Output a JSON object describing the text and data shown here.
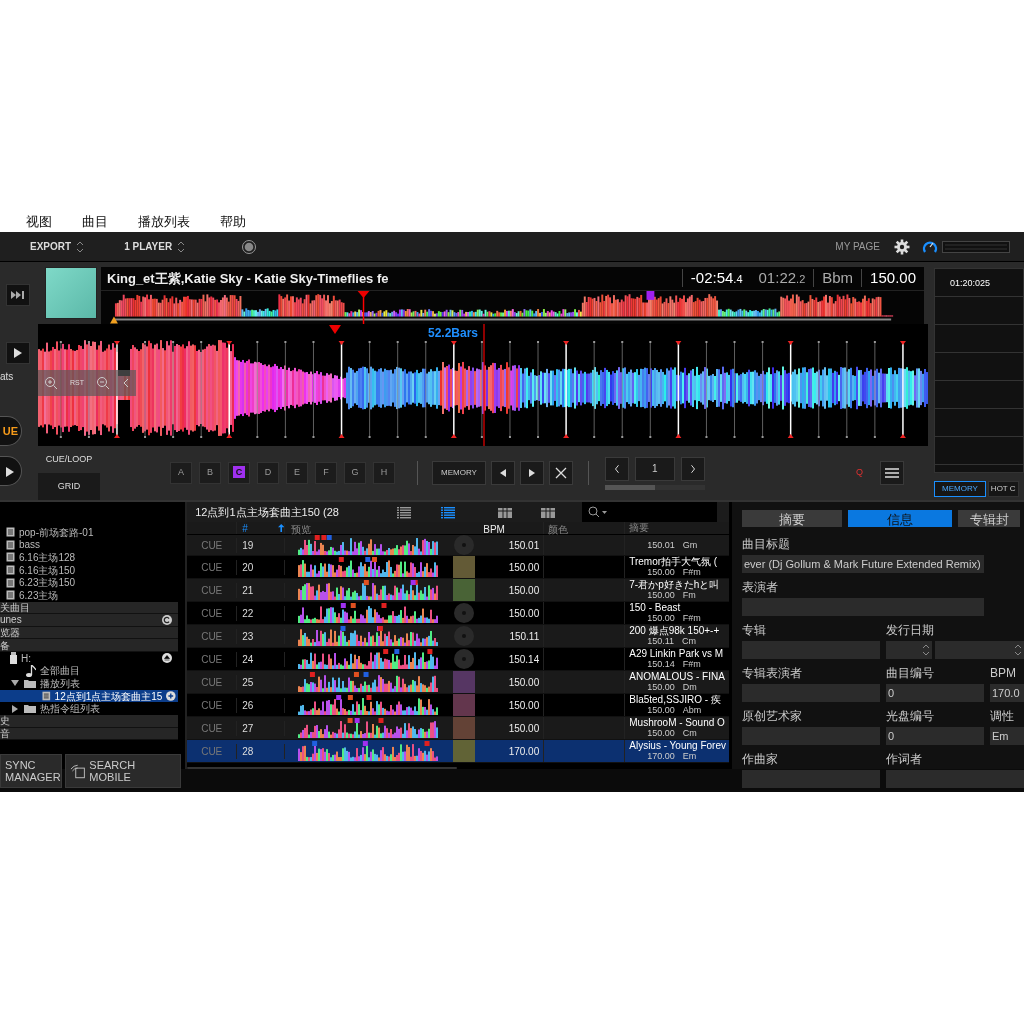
{
  "menu": [
    "视图",
    "曲目",
    "播放列表",
    "帮助"
  ],
  "toolbar": {
    "export": "EXPORT",
    "players": "1 PLAYER",
    "my_page": "MY PAGE"
  },
  "deck": {
    "side_labels": [
      "ats",
      "UE"
    ],
    "title": "King_et王紫,Katie Sky - Katie Sky-Timeflies fe",
    "remaining": "-02:54",
    "remaining_tenths": ".4",
    "elapsed": "01:22",
    "elapsed_tenths": ".2",
    "key": "Bbm",
    "bpm": "150.00",
    "bars": "52.2Bars",
    "zoom_reset": "RST",
    "mode_tabs": [
      {
        "label": "CUE/LOOP",
        "selected": true
      },
      {
        "label": "GRID",
        "selected": false
      }
    ],
    "hot_cues": [
      {
        "label": "A",
        "set": false
      },
      {
        "label": "B",
        "set": false
      },
      {
        "label": "C",
        "set": true
      },
      {
        "label": "D",
        "set": false
      },
      {
        "label": "E",
        "set": false
      },
      {
        "label": "F",
        "set": false
      },
      {
        "label": "G",
        "set": false
      },
      {
        "label": "H",
        "set": false
      }
    ],
    "memory_button": "MEMORY",
    "loop_value": "1",
    "loop_progress": {
      "level": 0.5
    },
    "quantize": "Q"
  },
  "memory_panel": {
    "cues": [
      "01:20:025"
    ],
    "tabs": [
      {
        "label": "MEMORY",
        "selected": true
      },
      {
        "label": "HOT C",
        "selected": false
      }
    ]
  },
  "tree": [
    {
      "kind": "playlist",
      "label": "pop-前场套路-01",
      "selected": false
    },
    {
      "kind": "playlist",
      "label": "bass",
      "selected": false
    },
    {
      "kind": "playlist",
      "label": "6.16主场128",
      "selected": false
    },
    {
      "kind": "playlist",
      "label": "6.16主场150",
      "selected": false
    },
    {
      "kind": "playlist",
      "label": "6.23主场150",
      "selected": false
    },
    {
      "kind": "playlist",
      "label": "6.23主场",
      "selected": false
    },
    {
      "kind": "section",
      "label": "关曲目"
    },
    {
      "kind": "library",
      "label": "unes"
    },
    {
      "kind": "section",
      "label": "览器"
    },
    {
      "kind": "section",
      "label": "备",
      "children": [
        {
          "kind": "device",
          "label": "H:",
          "children": [
            {
              "kind": "all",
              "label": "全部曲目"
            },
            {
              "kind": "folder",
              "label": "播放列表",
              "expanded": true,
              "children": [
                {
                  "kind": "playlist",
                  "label": "12点到1点主场套曲主15",
                  "selected": true
                }
              ]
            },
            {
              "kind": "folder",
              "label": "热指令组列表",
              "expanded": false
            }
          ]
        }
      ]
    },
    {
      "kind": "section",
      "label": "史"
    },
    {
      "kind": "section",
      "label": "音"
    }
  ],
  "tree_buttons": [
    "SYNC MANAGER",
    "SEARCH MOBILE"
  ],
  "track_list": {
    "title": "12点到1点主场套曲主150 (28",
    "view_buttons": [
      {
        "kind": "list",
        "selected": false
      },
      {
        "kind": "list",
        "selected": true
      },
      {
        "kind": "grid",
        "selected": false
      },
      {
        "kind": "grid",
        "selected": false
      }
    ],
    "columns": [
      "#",
      "预览",
      "BPM",
      "颜色",
      "摘要"
    ],
    "rows": [
      {
        "cue": "CUE",
        "number": "19",
        "bpm": "150.01",
        "summary_bpm": "150.01",
        "key": "Gm",
        "has_artwork": false,
        "selected": false
      },
      {
        "cue": "CUE",
        "number": "20",
        "bpm": "150.00",
        "title": "Tremor拍手大气氛 (",
        "summary_bpm": "150.00",
        "key": "F#m",
        "has_artwork": true,
        "selected": false
      },
      {
        "cue": "CUE",
        "number": "21",
        "bpm": "150.00",
        "title": "7-君かp好きたhと叫",
        "summary_bpm": "150.00",
        "key": "Fm",
        "has_artwork": true,
        "selected": false
      },
      {
        "cue": "CUE",
        "number": "22",
        "bpm": "150.00",
        "title": "150 - Beast",
        "summary_bpm": "150.00",
        "key": "F#m",
        "has_artwork": false,
        "selected": false
      },
      {
        "cue": "CUE",
        "number": "23",
        "bpm": "150.11",
        "title": "200 爆点98k 150+-+",
        "summary_bpm": "150.11",
        "key": "Cm",
        "has_artwork": false,
        "selected": false
      },
      {
        "cue": "CUE",
        "number": "24",
        "bpm": "150.14",
        "title": "A29  Linkin Park vs M",
        "summary_bpm": "150.14",
        "key": "F#m",
        "has_artwork": false,
        "selected": false
      },
      {
        "cue": "CUE",
        "number": "25",
        "bpm": "150.00",
        "title": "ANOMALOUS - FINA",
        "summary_bpm": "150.00",
        "key": "Dm",
        "has_artwork": true,
        "selected": false
      },
      {
        "cue": "CUE",
        "number": "26",
        "bpm": "150.00",
        "title": "Bla5ted,SSJIRO - 疾",
        "summary_bpm": "150.00",
        "key": "Abm",
        "has_artwork": true,
        "selected": false
      },
      {
        "cue": "CUE",
        "number": "27",
        "bpm": "150.00",
        "title": "MushrooM - Sound O",
        "summary_bpm": "150.00",
        "key": "Cm",
        "has_artwork": true,
        "selected": false
      },
      {
        "cue": "CUE",
        "number": "28",
        "bpm": "170.00",
        "title": "Alysius - Young Forev",
        "summary_bpm": "170.00",
        "key": "Em",
        "has_artwork": true,
        "selected": true
      }
    ]
  },
  "info": {
    "tabs": [
      {
        "label": "摘要",
        "selected": false
      },
      {
        "label": "信息",
        "selected": true
      },
      {
        "label": "专辑封",
        "selected": false
      }
    ],
    "rows": [
      [
        {
          "kind": "text",
          "label": "曲目标题",
          "value": "ever (Dj Gollum & Mark Future Extended Remix)"
        }
      ],
      [
        {
          "kind": "text",
          "label": "表演者"
        }
      ],
      [
        {
          "kind": "text",
          "label": "专辑"
        },
        {
          "kind": "date",
          "label": "发行日期"
        }
      ],
      [
        {
          "kind": "text",
          "label": "专辑表演者"
        },
        {
          "kind": "text",
          "label": "曲目编号",
          "value": "0"
        },
        {
          "kind": "text",
          "label": "BPM",
          "value": "170.0"
        }
      ],
      [
        {
          "kind": "text",
          "label": "原创艺术家"
        },
        {
          "kind": "text",
          "label": "光盘编号",
          "value": "0"
        },
        {
          "kind": "text",
          "label": "调性",
          "value": "Em"
        }
      ],
      [
        {
          "kind": "text",
          "label": "作曲家"
        },
        {
          "kind": "text",
          "label": "作词者"
        }
      ]
    ]
  }
}
